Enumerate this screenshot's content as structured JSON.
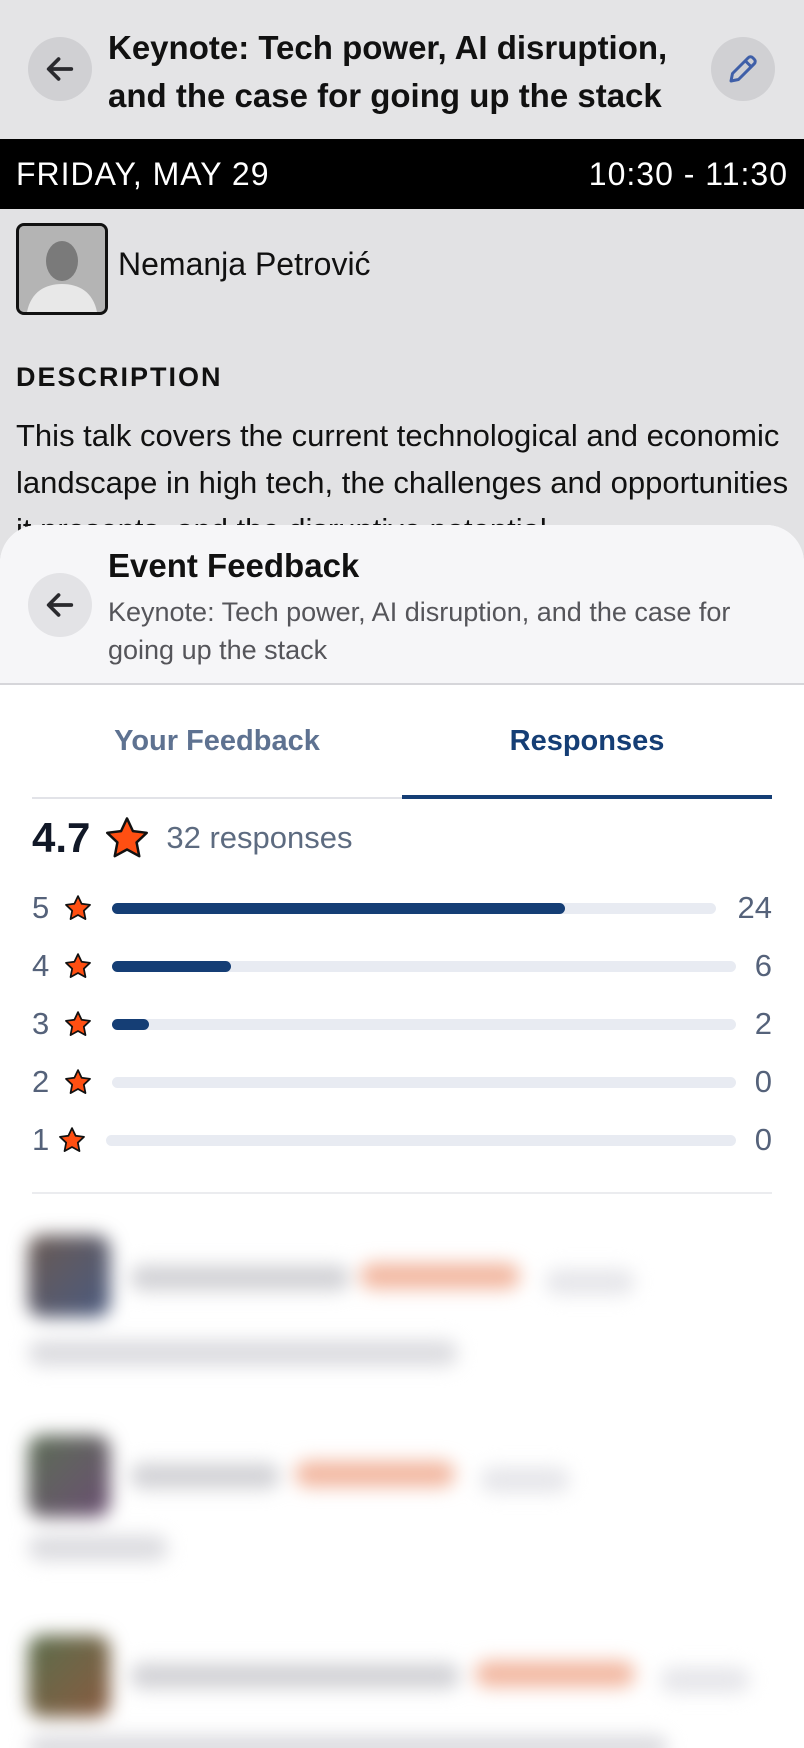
{
  "event": {
    "title": "Keynote: Tech power, AI disruption, and the case for going up the stack",
    "date": "FRIDAY, MAY 29",
    "time": "10:30 - 11:30",
    "speaker": "Nemanja Petrović",
    "description_heading": "DESCRIPTION",
    "description": "This talk covers the current technological and economic landscape in high tech, the challenges and opportunities it presents, and the disruptive potential"
  },
  "feedback": {
    "title": "Event Feedback",
    "subtitle": "Keynote: Tech power, AI disruption, and the case for going up the stack",
    "tabs": [
      {
        "label": "Your Feedback",
        "active": false
      },
      {
        "label": "Responses",
        "active": true
      }
    ],
    "average": "4.7",
    "responses": "32 responses",
    "distribution": [
      {
        "stars": "5",
        "count": "24",
        "fraction": 0.75
      },
      {
        "stars": "4",
        "count": "6",
        "fraction": 0.19
      },
      {
        "stars": "3",
        "count": "2",
        "fraction": 0.06
      },
      {
        "stars": "2",
        "count": "0",
        "fraction": 0
      },
      {
        "stars": "1",
        "count": "0",
        "fraction": 0
      }
    ]
  },
  "colors": {
    "accent": "#153e75",
    "star": "#ff4f12",
    "track": "#e8ebf2"
  },
  "icons": [
    "back-arrow-icon",
    "edit-pencil-icon",
    "star-icon"
  ]
}
